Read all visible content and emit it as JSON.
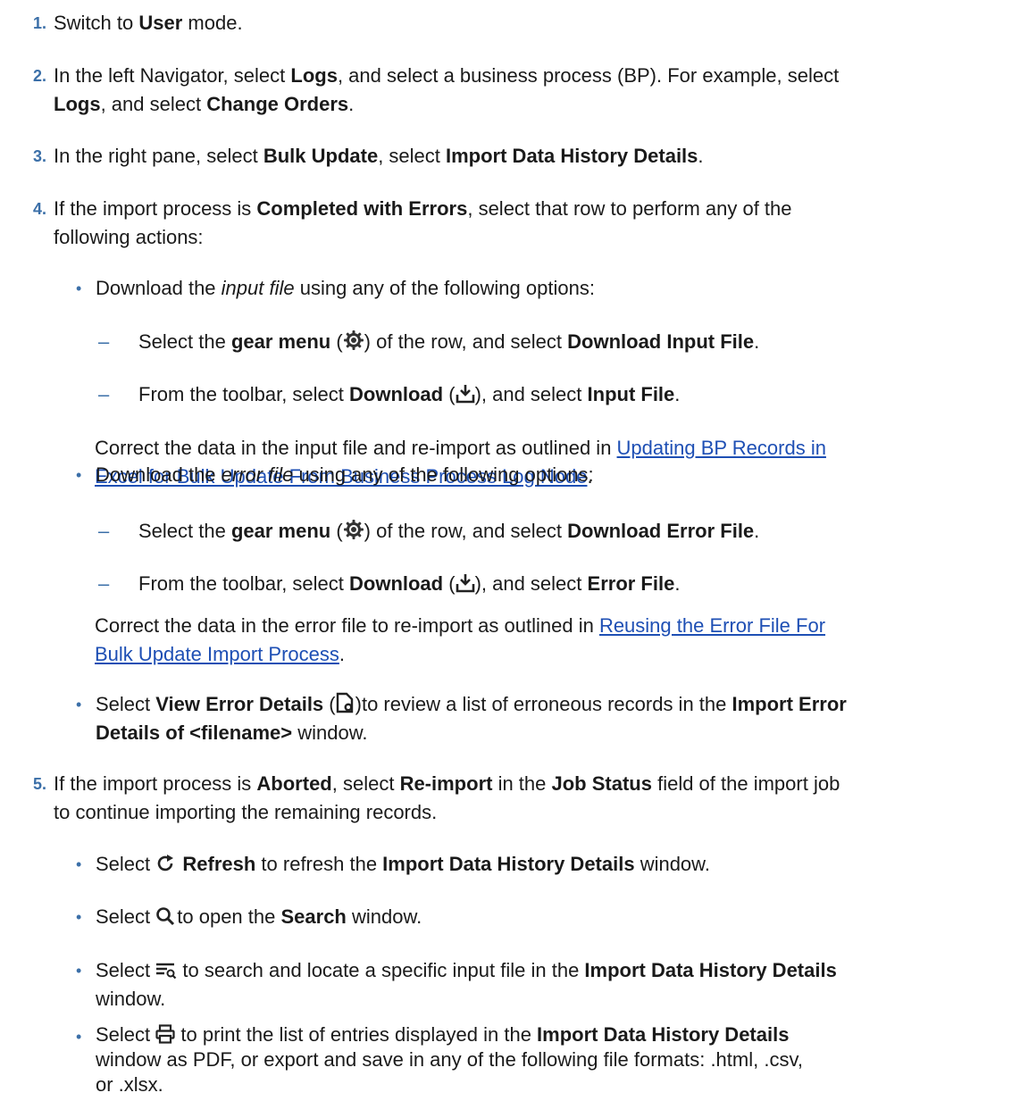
{
  "steps": [
    {
      "num": "1.",
      "pre": "Switch to ",
      "b1": "User",
      "post": " mode."
    },
    {
      "num": "2.",
      "t1": "In the left Navigator, select ",
      "b1": "Logs",
      "t2": ", and select a business process (BP). For example, select",
      "b2": "Logs",
      "t3": ", and select ",
      "b3": "Change Orders",
      "t4": "."
    },
    {
      "num": "3.",
      "t1": "In the right pane, select ",
      "b1": "Bulk Update",
      "t2": ", select ",
      "b2": "Import Data History Details",
      "t3": "."
    },
    {
      "num": "4.",
      "t1": "If the import process is ",
      "b1": "Completed with Errors",
      "t2": ", select that row to perform any of the",
      "t3": "following actions:"
    },
    {
      "num": "5.",
      "t1": "If the import process is ",
      "b1": "Aborted",
      "t2": ", select ",
      "b2": "Re-import",
      "t3": " in the ",
      "b3": "Job Status",
      "t4": " field of the import job",
      "t5": "to continue importing the remaining records."
    }
  ],
  "input_file": {
    "t1": "Download the ",
    "i1": "input file",
    "t2": " using any of the following options:",
    "gear": {
      "t1": "Select the ",
      "b1": "gear menu",
      "t2": " (",
      "t3": ") of the row, and select ",
      "b2": "Download Input File",
      "t4": "."
    },
    "download": {
      "t1": "From the toolbar, select ",
      "b1": "Download",
      "t2": " (",
      "t3": "), and select ",
      "b2": "Input File",
      "t4": "."
    },
    "correct": "Correct the data in the input file and re-import as outlined in ",
    "link_l1": "Updating BP Records in",
    "link_l2": "Excel for Bulk Update From Business Process Log Node",
    "end": "."
  },
  "error_file": {
    "t1": "Download the ",
    "i1": "error file",
    "t2": " using any of the following options:",
    "gear": {
      "t1": "Select the ",
      "b1": "gear menu",
      "t2": " (",
      "t3": ") of the row, and select ",
      "b2": "Download Error File",
      "t4": "."
    },
    "download": {
      "t1": "From the toolbar, select ",
      "b1": "Download",
      "t2": " (",
      "t3": "), and select ",
      "b2": "Error File",
      "t4": "."
    },
    "correct": "Correct the data in the error file to re-import as outlined in ",
    "link_l1": "Reusing the Error File For",
    "link_l2": "Bulk Update Import Process",
    "end": "."
  },
  "view_error": {
    "t1": "Select ",
    "b1": "View Error Details",
    "t2": " (",
    "t3": ")to review a list of erroneous records in the ",
    "b2": "Import Error",
    "b3": "Details of <filename>",
    "t4": " window."
  },
  "refresh": {
    "t1": "Select ",
    "b1": "Refresh",
    "t2": " to refresh the ",
    "b2": "Import Data History Details",
    "t3": " window."
  },
  "search": {
    "t1": "Select ",
    "t2": "to open the ",
    "b1": "Search",
    "t3": " window."
  },
  "filter": {
    "t1": "Select ",
    "t2": " to search and locate a specific input file in the ",
    "b1": "Import Data History Details",
    "t3": "window."
  },
  "print": {
    "t1": "Select ",
    "t2": " to print the list of entries displayed in the ",
    "b1": "Import Data History Details",
    "t3": "window as PDF, or export and save in any of the following file formats: .html, .csv,",
    "t4": "or .xlsx."
  },
  "bullet_char": "•",
  "dash_char": "–"
}
